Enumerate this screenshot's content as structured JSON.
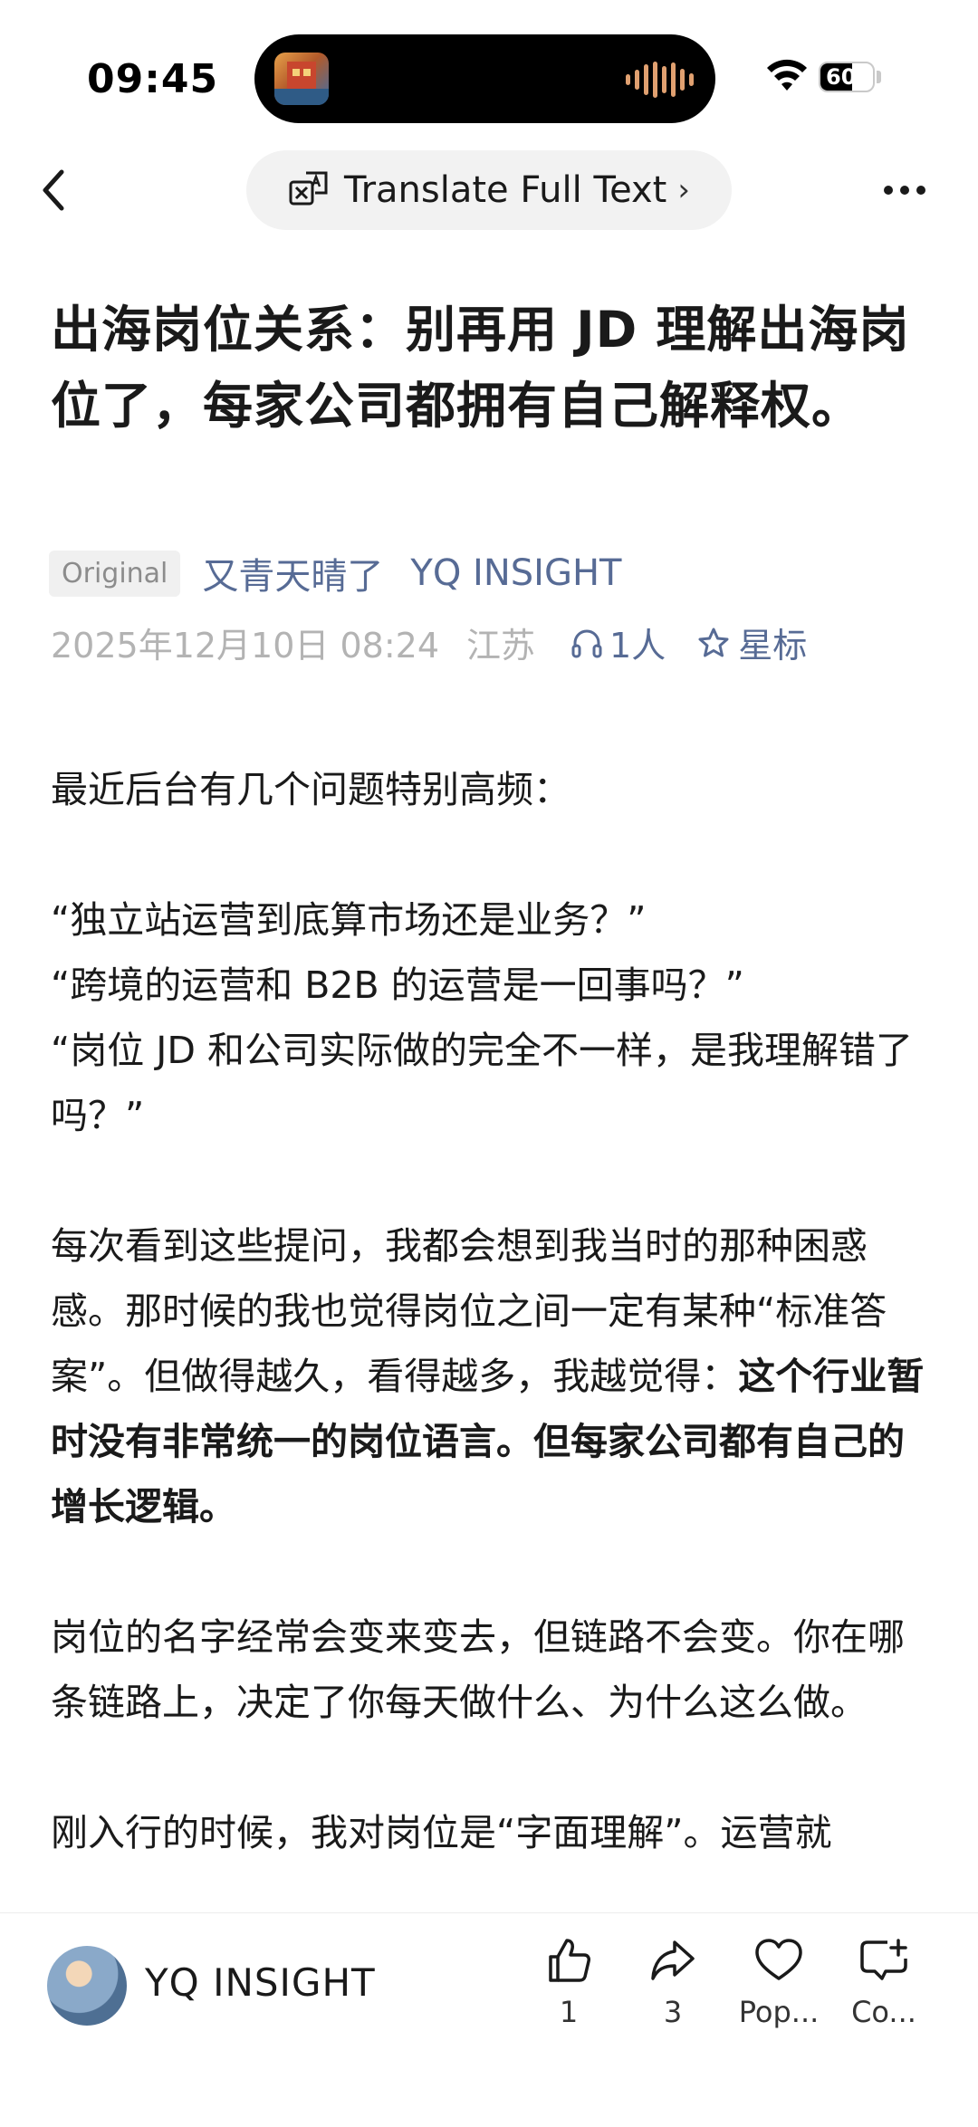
{
  "status_bar": {
    "time": "09:45",
    "battery": "60",
    "battery_level": 0.6,
    "icons": [
      "now-playing-artwork-icon",
      "audio-wave-icon",
      "wifi-icon",
      "battery-icon"
    ]
  },
  "nav": {
    "translate_label": "Translate Full Text",
    "icons": [
      "back-chevron-icon",
      "translate-icon",
      "chevron-right-icon",
      "more-icon"
    ]
  },
  "article": {
    "title": "出海岗位关系：别再用 JD 理解出海岗位了，每家公司都拥有自己解释权。",
    "tag": "Original",
    "author": "又青天晴了",
    "account": "YQ INSIGHT",
    "date": "2025年12月10日 08:24",
    "location": "江苏",
    "listeners": "1人",
    "star_label": "星标",
    "paragraphs": {
      "p1": "最近后台有几个问题特别高频：",
      "q1": "“独立站运营到底算市场还是业务？”",
      "q2": "“跨境的运营和 B2B 的运营是一回事吗？”",
      "q3": "“岗位 JD 和公司实际做的完全不一样，是我理解错了吗？”",
      "p3_normal": "每次看到这些提问，我都会想到我当时的那种困惑感。那时候的我也觉得岗位之间一定有某种“标准答案”。但做得越久，看得越多，我越觉得：",
      "p3_bold": "这个行业暂时没有非常统一的岗位语言。但每家公司都有自己的增长逻辑。",
      "p4": "岗位的名字经常会变来变去，但链路不会变。你在哪条链路上，决定了你每天做什么、为什么这么做。",
      "p5": "刚入行的时候，我对岗位是“字面理解”。运营就"
    }
  },
  "bottom_bar": {
    "account_name": "YQ INSIGHT",
    "like_count": "1",
    "share_count": "3",
    "favorite_label": "Pop...",
    "comment_label": "Co..."
  }
}
